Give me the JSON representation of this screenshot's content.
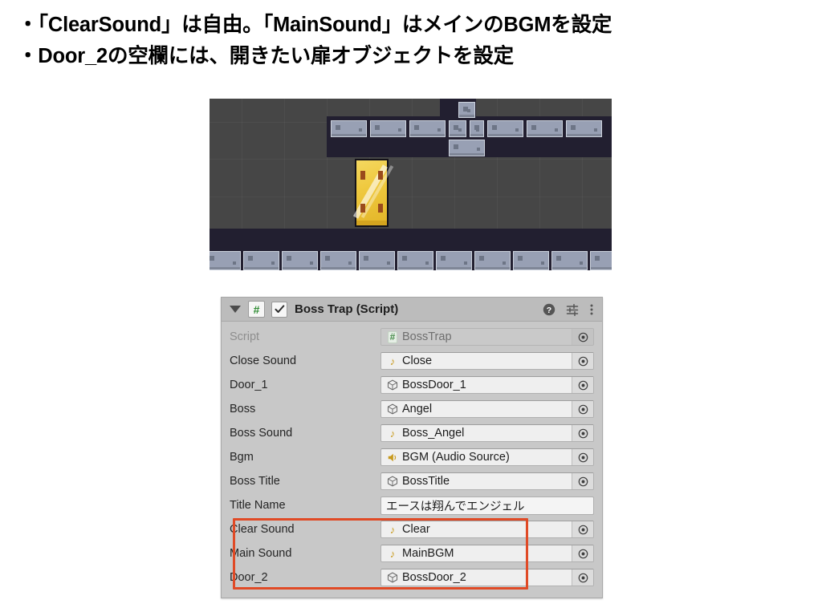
{
  "notes": {
    "lines": [
      "・「ClearSound」は自由。「MainSound」はメインのBGMを設定",
      "・Door_2の空欄には、開きたい扉オブジェクトを設定"
    ]
  },
  "game_screenshot": {
    "caption": "Unity 2D platformer scene: grey brick platforms on a dark background with a yellow door in the centre"
  },
  "inspector": {
    "header": {
      "foldout_state": "expanded",
      "script_badge": "#",
      "enabled": true,
      "title": "Boss Trap (Script)",
      "help_icon": "help-icon",
      "preset_icon": "preset-icon",
      "menu_icon": "kebab-menu-icon"
    },
    "rows": [
      {
        "label": "Script",
        "field_type": "object",
        "icon": "script-icon",
        "value": "BossTrap",
        "readonly": true,
        "picker": true,
        "highlighted": false
      },
      {
        "label": "Close Sound",
        "field_type": "object",
        "icon": "audio-clip-icon",
        "value": "Close",
        "readonly": false,
        "picker": true,
        "highlighted": false
      },
      {
        "label": "Door_1",
        "field_type": "object",
        "icon": "game-object-icon",
        "value": "BossDoor_1",
        "readonly": false,
        "picker": true,
        "highlighted": false
      },
      {
        "label": "Boss",
        "field_type": "object",
        "icon": "game-object-icon",
        "value": "Angel",
        "readonly": false,
        "picker": true,
        "highlighted": false
      },
      {
        "label": "Boss Sound",
        "field_type": "object",
        "icon": "audio-clip-icon",
        "value": "Boss_Angel",
        "readonly": false,
        "picker": true,
        "highlighted": false
      },
      {
        "label": "Bgm",
        "field_type": "object",
        "icon": "audio-source-icon",
        "value": "BGM (Audio Source)",
        "readonly": false,
        "picker": true,
        "highlighted": false
      },
      {
        "label": "Boss Title",
        "field_type": "object",
        "icon": "game-object-icon",
        "value": "BossTitle",
        "readonly": false,
        "picker": true,
        "highlighted": false
      },
      {
        "label": "Title Name",
        "field_type": "text",
        "icon": "",
        "value": "エースは翔んでエンジェル",
        "readonly": false,
        "picker": false,
        "highlighted": false
      },
      {
        "label": "Clear Sound",
        "field_type": "object",
        "icon": "audio-clip-icon",
        "value": "Clear",
        "readonly": false,
        "picker": true,
        "highlighted": true
      },
      {
        "label": "Main Sound",
        "field_type": "object",
        "icon": "audio-clip-icon",
        "value": "MainBGM",
        "readonly": false,
        "picker": true,
        "highlighted": true
      },
      {
        "label": "Door_2",
        "field_type": "object",
        "icon": "game-object-icon",
        "value": "BossDoor_2",
        "readonly": false,
        "picker": true,
        "highlighted": true
      }
    ]
  },
  "colors": {
    "highlight_border": "#e04a26",
    "panel_background": "#c8c8c8",
    "panel_header": "#bcbcbc",
    "field_background": "#efefef",
    "audio_icon": "#c89a1e",
    "script_green": "#2e8b32",
    "door_yellow": "#efc93f",
    "scene_background": "#464646",
    "platform_dark": "#221f30",
    "brick_grey": "#98a0b4"
  }
}
